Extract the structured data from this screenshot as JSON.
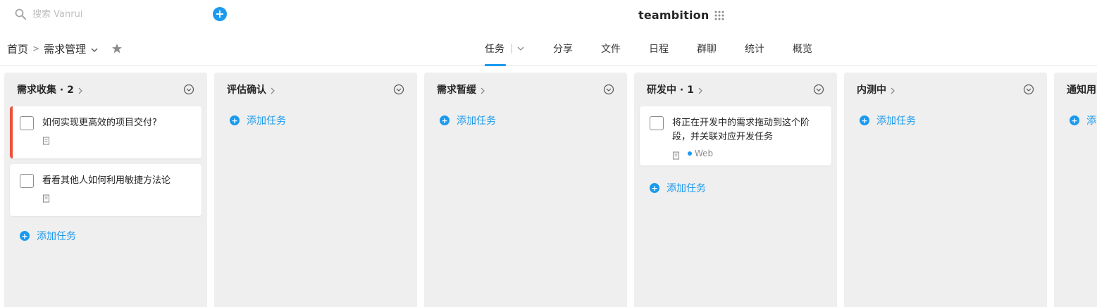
{
  "topbar": {
    "search_placeholder": "搜索 Vanrui",
    "add_label": "+",
    "brand": "teambition"
  },
  "breadcrumb": {
    "home": "首页",
    "separator": ">",
    "project": "需求管理"
  },
  "tabs": [
    {
      "label": "任务",
      "active": true
    },
    {
      "label": "分享"
    },
    {
      "label": "文件"
    },
    {
      "label": "日程"
    },
    {
      "label": "群聊"
    },
    {
      "label": "统计"
    },
    {
      "label": "概览"
    }
  ],
  "columns": [
    {
      "title": "需求收集 · 2",
      "cards": [
        {
          "title": "如何实现更高效的项目交付?",
          "urgent": true
        },
        {
          "title": "看看其他人如何利用敏捷方法论",
          "urgent": false
        }
      ],
      "add_task": "添加任务"
    },
    {
      "title": "评估确认",
      "cards": [],
      "add_task": "添加任务"
    },
    {
      "title": "需求暂缓",
      "cards": [],
      "add_task": "添加任务"
    },
    {
      "title": "研发中 · 1",
      "cards": [
        {
          "title": "将正在开发中的需求拖动到这个阶段，并关联对应开发任务",
          "tag": "Web"
        }
      ],
      "add_task": "添加任务"
    },
    {
      "title": "内测中",
      "cards": [],
      "add_task": "添加任务"
    },
    {
      "title": "通知用",
      "cards": [],
      "add_task": "添"
    }
  ],
  "colors": {
    "accent": "#1b9aee",
    "urgent": "#e8533b",
    "column_bg": "#efefef"
  },
  "icons": [
    "search-icon",
    "plus-icon",
    "grid-icon",
    "chevron-down-icon",
    "star-icon",
    "chevron-right-icon",
    "column-menu-icon",
    "document-icon",
    "add-circle-icon"
  ]
}
